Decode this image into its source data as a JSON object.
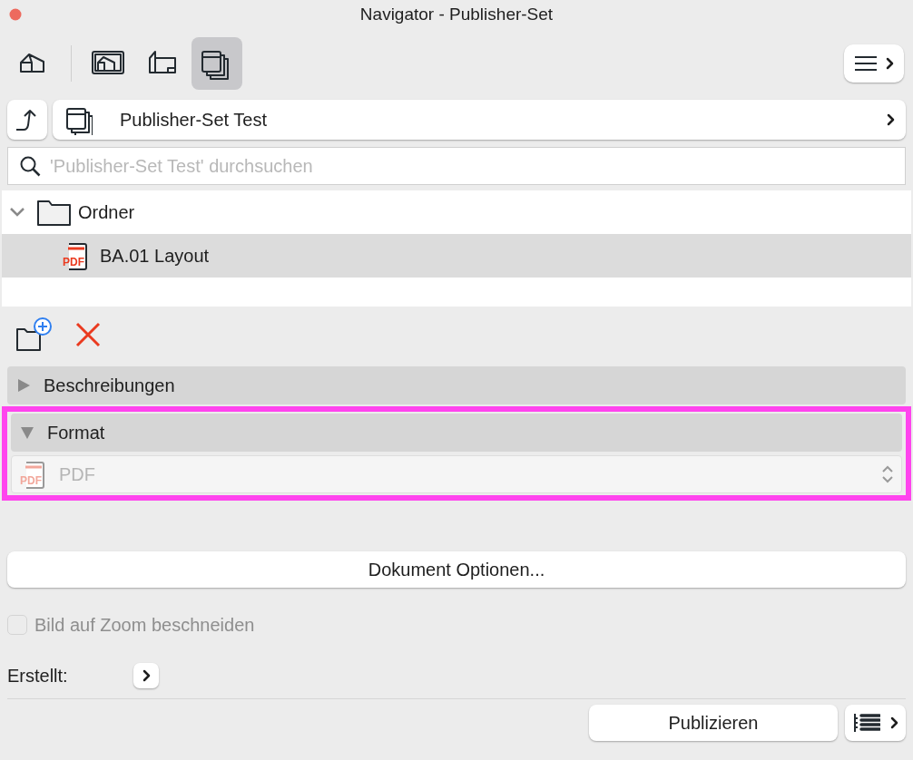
{
  "window": {
    "title": "Navigator - Publisher-Set"
  },
  "toolbar": {
    "views": [
      {
        "kind": "project",
        "selected": false
      },
      {
        "kind": "views",
        "selected": false
      },
      {
        "kind": "layouts",
        "selected": false
      },
      {
        "kind": "publisher",
        "selected": true
      }
    ]
  },
  "path": {
    "label": "Publisher-Set Test"
  },
  "search": {
    "placeholder": "'Publisher-Set Test' durchsuchen"
  },
  "tree": [
    {
      "label": "Ordner",
      "kind": "folder",
      "expanded": true,
      "selected": false,
      "children": [
        {
          "label": "BA.01 Layout",
          "kind": "pdf",
          "icon_text": "PDF",
          "selected": true
        }
      ]
    }
  ],
  "sections": [
    {
      "title": "Beschreibungen",
      "expanded": false,
      "highlighted": false
    },
    {
      "title": "Format",
      "expanded": true,
      "highlighted": true,
      "format": {
        "icon_text": "PDF",
        "value": "PDF",
        "disabled": true
      }
    }
  ],
  "document_options_button": "Dokument Optionen...",
  "crop_checkbox": {
    "label": "Bild auf Zoom beschneiden",
    "checked": false,
    "disabled": true
  },
  "created": {
    "label": "Erstellt:"
  },
  "publish_button": "Publizieren"
}
